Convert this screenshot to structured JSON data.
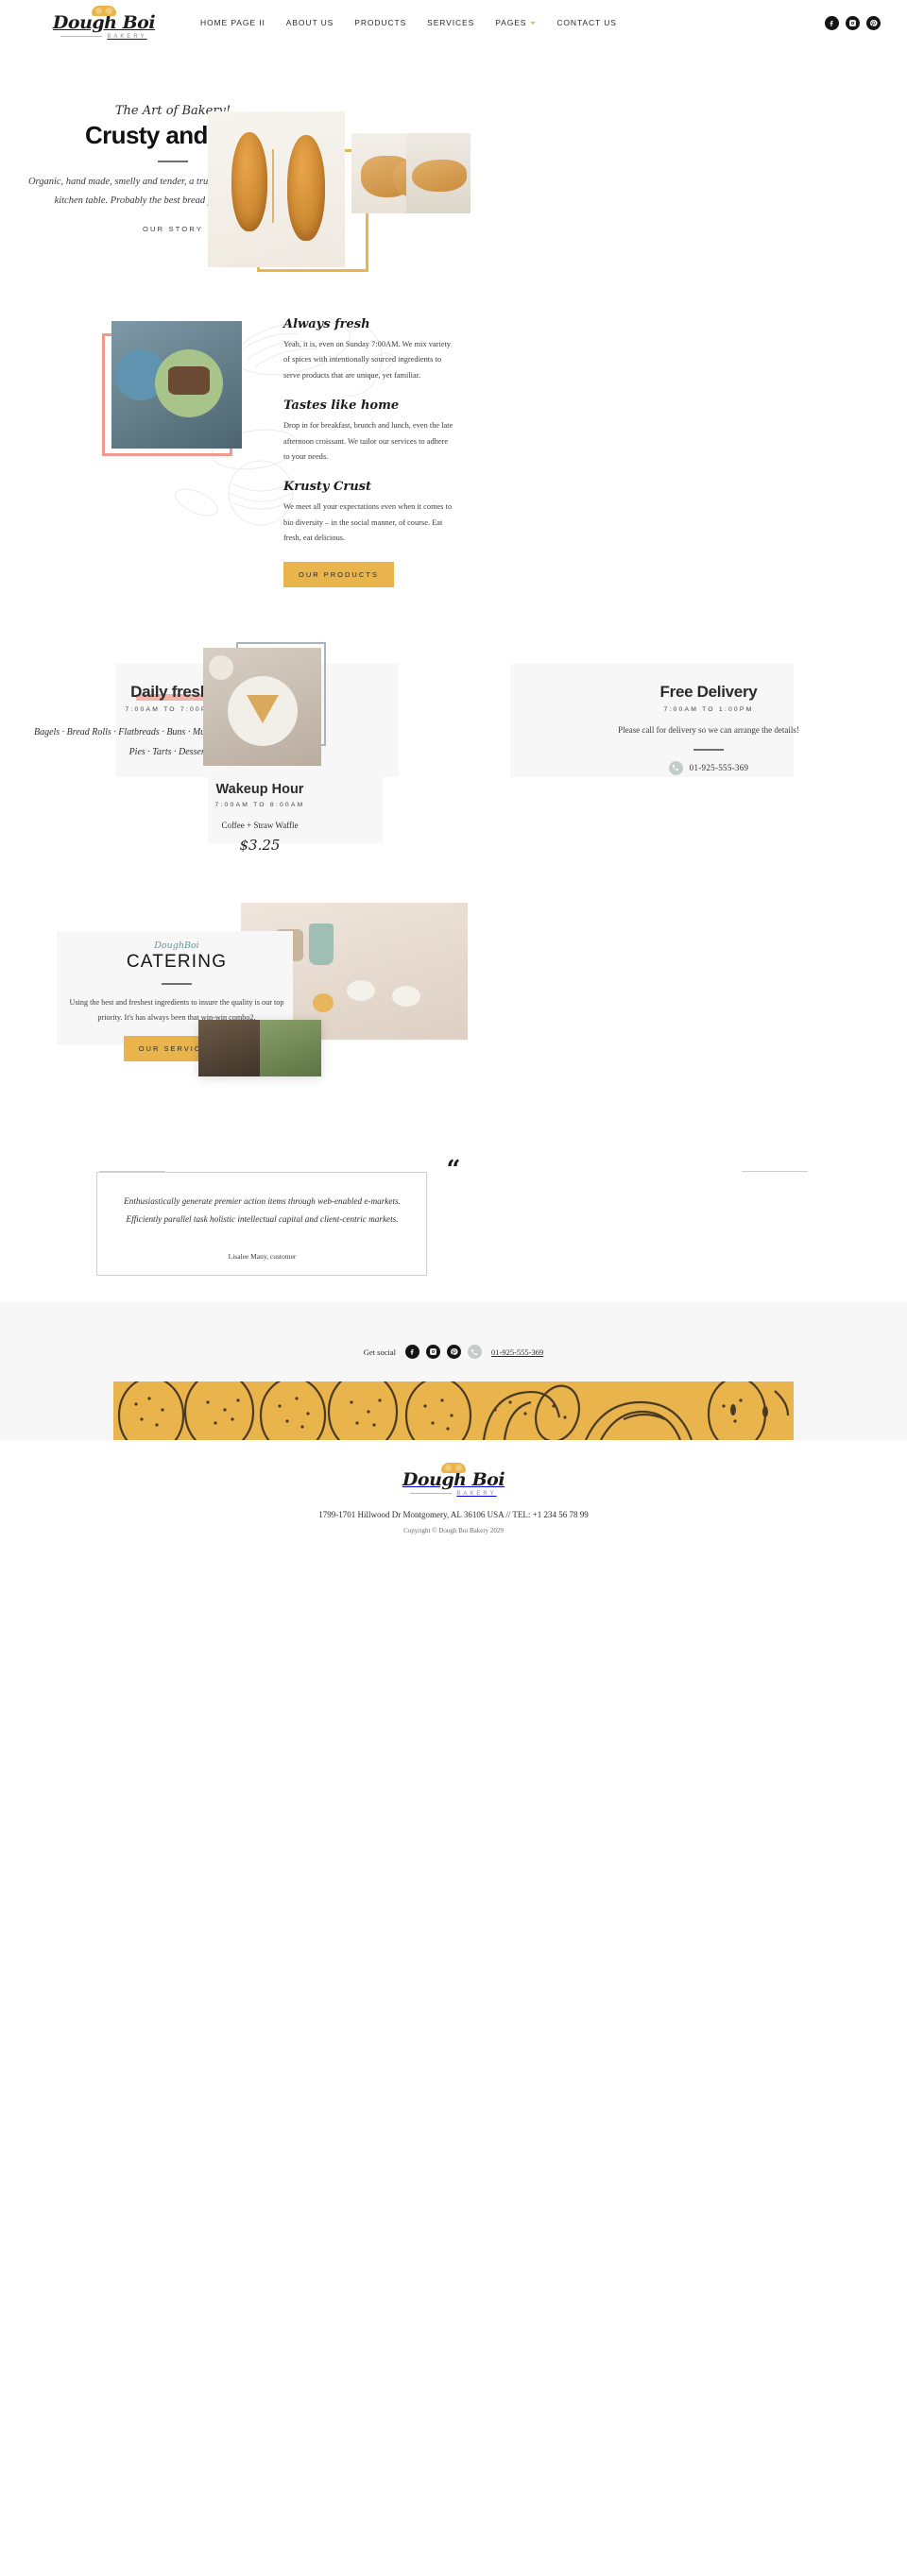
{
  "brand": {
    "name": "Dough Boi",
    "tagline": "BAKERY",
    "loaf_icon": "bread-loaf-icon"
  },
  "header": {
    "nav": [
      {
        "label": "HOME PAGE II",
        "has_caret": false
      },
      {
        "label": "ABOUT US",
        "has_caret": false
      },
      {
        "label": "PRODUCTS",
        "has_caret": false
      },
      {
        "label": "SERVICES",
        "has_caret": false
      },
      {
        "label": "PAGES",
        "has_caret": true
      },
      {
        "label": "CONTACT US",
        "has_caret": false
      }
    ],
    "social": [
      "facebook-icon",
      "instagram-icon",
      "pinterest-icon"
    ]
  },
  "hero": {
    "eyebrow": "The Art of Bakery!",
    "title": "Crusty and chic",
    "paragraph": "Organic, hand made, smelly and tender, a true piece of art, right on your kitchen table. Probably the best bread you have ever tasted.",
    "cta": "OUR STORY"
  },
  "features": {
    "items": [
      {
        "heading": "Always fresh",
        "body": "Yeah, it is, even on Sunday 7:00AM. We mix variety of spices with intentionally sourced ingredients to serve products that are unique, yet familiar."
      },
      {
        "heading": "Tastes like home",
        "body": "Drop in for breakfast, brunch and lunch, even the late afternoon croissant. We tailor our services to adhere to your needs."
      },
      {
        "heading": "Krusty Crust",
        "body": "We meet all your expectations even when it comes to bio diversity – in the social manner, of course. Eat fresh, eat delicious."
      }
    ],
    "cta": "OUR PRODUCTS"
  },
  "menu": {
    "daily": {
      "title": "Daily fresh",
      "hours": "7:00AM TO 7:00PM",
      "products": "Bagels · Bread Rolls · Flatbreads · Buns · Muffins · Brownies · Cookies · Pies · Tarts · Desserts"
    },
    "wakeup": {
      "title": "Wakeup Hour",
      "hours": "7:00AM TO 8:00AM",
      "combo": "Coffee + Straw Waffle",
      "price": "$3.25"
    },
    "delivery": {
      "title": "Free Delivery",
      "hours": "7:00AM TO 1:00PM",
      "note": "Please call for delivery so we can arrange the details!",
      "phone": "01-925-555-369",
      "phone_icon": "phone-icon"
    }
  },
  "catering": {
    "script": "DoughBoi",
    "title": "CATERING",
    "body": "Using the best and freshest ingredients to insure the quality is our top priority. It's has always been that win-win combo2.",
    "cta": "OUR SERVICES"
  },
  "testimonial": {
    "quote_mark": "“",
    "text": "Enthusiastically generate premier action items through web-enabled e-markets. Efficiently parallel task holistic intellectual capital and client-centric markets.",
    "author": "Lisalee Many, customer"
  },
  "footer": {
    "social_label": "Get social",
    "social": [
      "facebook-icon",
      "instagram-icon",
      "pinterest-icon"
    ],
    "phone_icon": "phone-icon",
    "phone": "01-925-555-369",
    "address": "1799-1701 Hillwood Dr Montgomery, AL 36106 USA // TEL: +1 234 56 78 99",
    "copyright": "Copyright © Dough Boi Bakery 2029"
  },
  "colors": {
    "gold": "#e9b44c",
    "pink": "#f1a79c",
    "teal": "#5b9c9a",
    "dark": "#1a1a1a",
    "panel": "#f7f7f7"
  }
}
